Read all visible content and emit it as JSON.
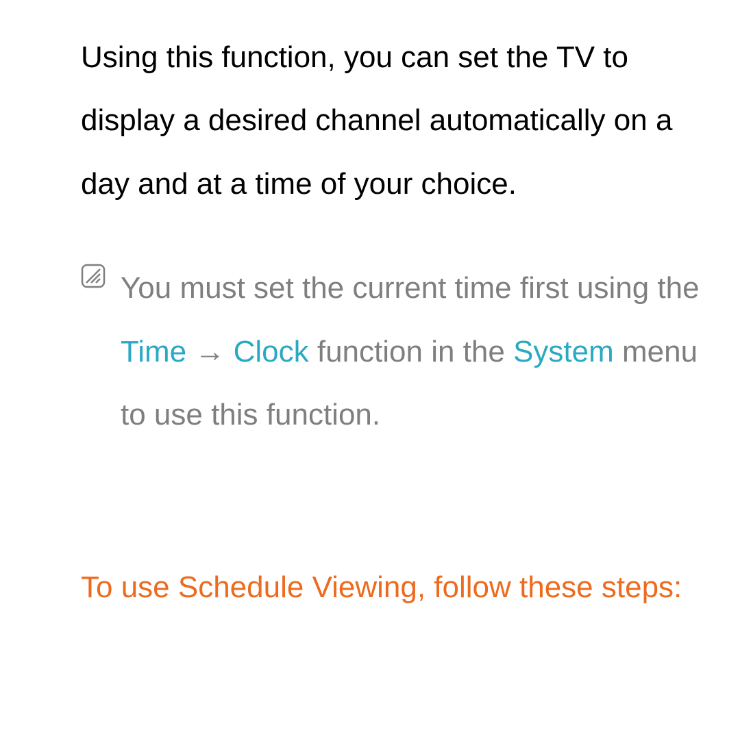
{
  "intro": "Using this function, you can set the TV to display a desired channel automatically on a day and at a time of your choice.",
  "note": {
    "segments": {
      "s1": "You must set the current time first using the ",
      "time": "Time",
      "arrow": " → ",
      "clock": "Clock",
      "s2": " function in the ",
      "system": "System",
      "s3": " menu to use this function."
    }
  },
  "steps_heading": "To use Schedule Viewing, follow these steps:"
}
